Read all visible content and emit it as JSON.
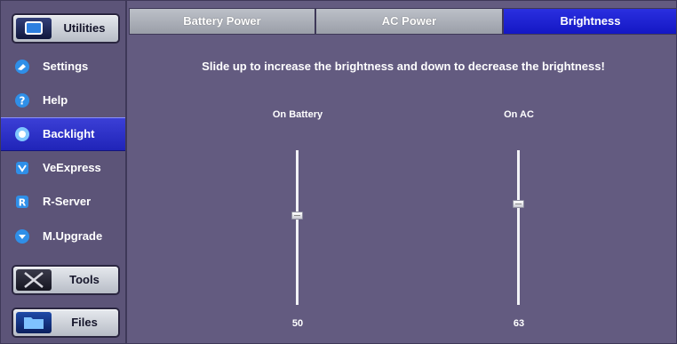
{
  "sidebar": {
    "top_button": {
      "label": "Utilities",
      "icon": "monitor-icon"
    },
    "items": [
      {
        "label": "Settings",
        "icon": "settings-icon",
        "active": false
      },
      {
        "label": "Help",
        "icon": "help-icon",
        "active": false
      },
      {
        "label": "Backlight",
        "icon": "backlight-icon",
        "active": true
      },
      {
        "label": "VeExpress",
        "icon": "veexpress-icon",
        "active": false
      },
      {
        "label": "R-Server",
        "icon": "r-server-icon",
        "active": false
      },
      {
        "label": "M.Upgrade",
        "icon": "upgrade-icon",
        "active": false
      }
    ],
    "tools_button": {
      "label": "Tools",
      "icon": "tools-icon"
    },
    "files_button": {
      "label": "Files",
      "icon": "folder-icon"
    }
  },
  "tabs": [
    {
      "label": "Battery Power",
      "active": false
    },
    {
      "label": "AC Power",
      "active": false
    },
    {
      "label": "Brightness",
      "active": true
    }
  ],
  "content": {
    "instruction": "Slide up to increase the brightness and down to decrease the brightness!",
    "sliders": [
      {
        "label": "On Battery",
        "value": "50",
        "fraction": 0.5
      },
      {
        "label": "On AC",
        "value": "63",
        "fraction": 0.63
      }
    ]
  },
  "colors": {
    "background": "#635b80",
    "active_blue": "#1f22c8",
    "tab_gray": "#aeb2bb"
  }
}
